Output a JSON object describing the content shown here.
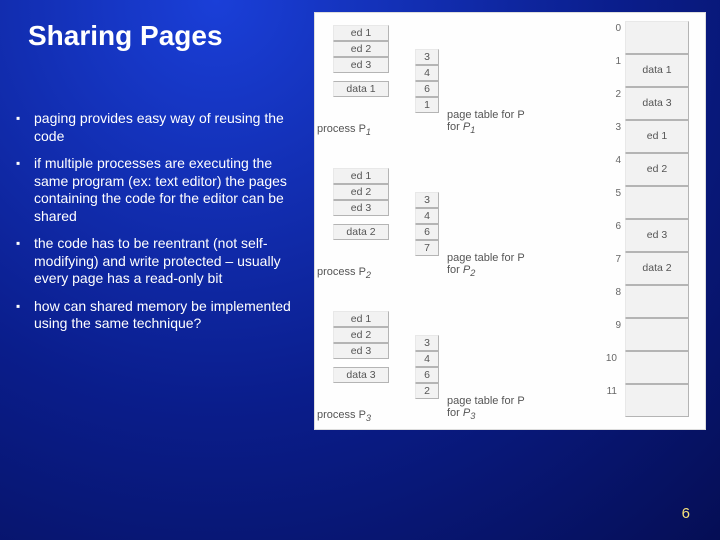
{
  "title": "Sharing Pages",
  "bullets": [
    "paging provides  easy way of reusing the code",
    "if multiple processes are executing the same program (ex: text editor) the pages  containing the code for the editor can be shared",
    "the code has to be reentrant (not self-modifying) and write protected – usually every page has a read-only bit",
    "how can shared memory be implemented using the same technique?"
  ],
  "page_number": "6",
  "diagram": {
    "processes": [
      {
        "name": "process P",
        "sub": "1",
        "pages": [
          "ed 1",
          "ed 2",
          "ed 3",
          "data 1"
        ],
        "pt": [
          "3",
          "4",
          "6",
          "1"
        ],
        "pt_label": "page table for P",
        "pt_sub": "1"
      },
      {
        "name": "process P",
        "sub": "2",
        "pages": [
          "ed 1",
          "ed 2",
          "ed 3",
          "data 2"
        ],
        "pt": [
          "3",
          "4",
          "6",
          "7"
        ],
        "pt_label": "page table for P",
        "pt_sub": "2"
      },
      {
        "name": "process P",
        "sub": "3",
        "pages": [
          "ed 1",
          "ed 2",
          "ed 3",
          "data 3"
        ],
        "pt": [
          "3",
          "4",
          "6",
          "2"
        ],
        "pt_label": "page table for P",
        "pt_sub": "3"
      }
    ],
    "memory": {
      "frames": [
        "",
        "data 1",
        "data 3",
        "ed 1",
        "ed 2",
        "",
        "ed 3",
        "data 2",
        "",
        "",
        "",
        ""
      ],
      "indices": [
        "0",
        "1",
        "2",
        "3",
        "4",
        "5",
        "6",
        "7",
        "8",
        "9",
        "10",
        "11"
      ]
    }
  }
}
